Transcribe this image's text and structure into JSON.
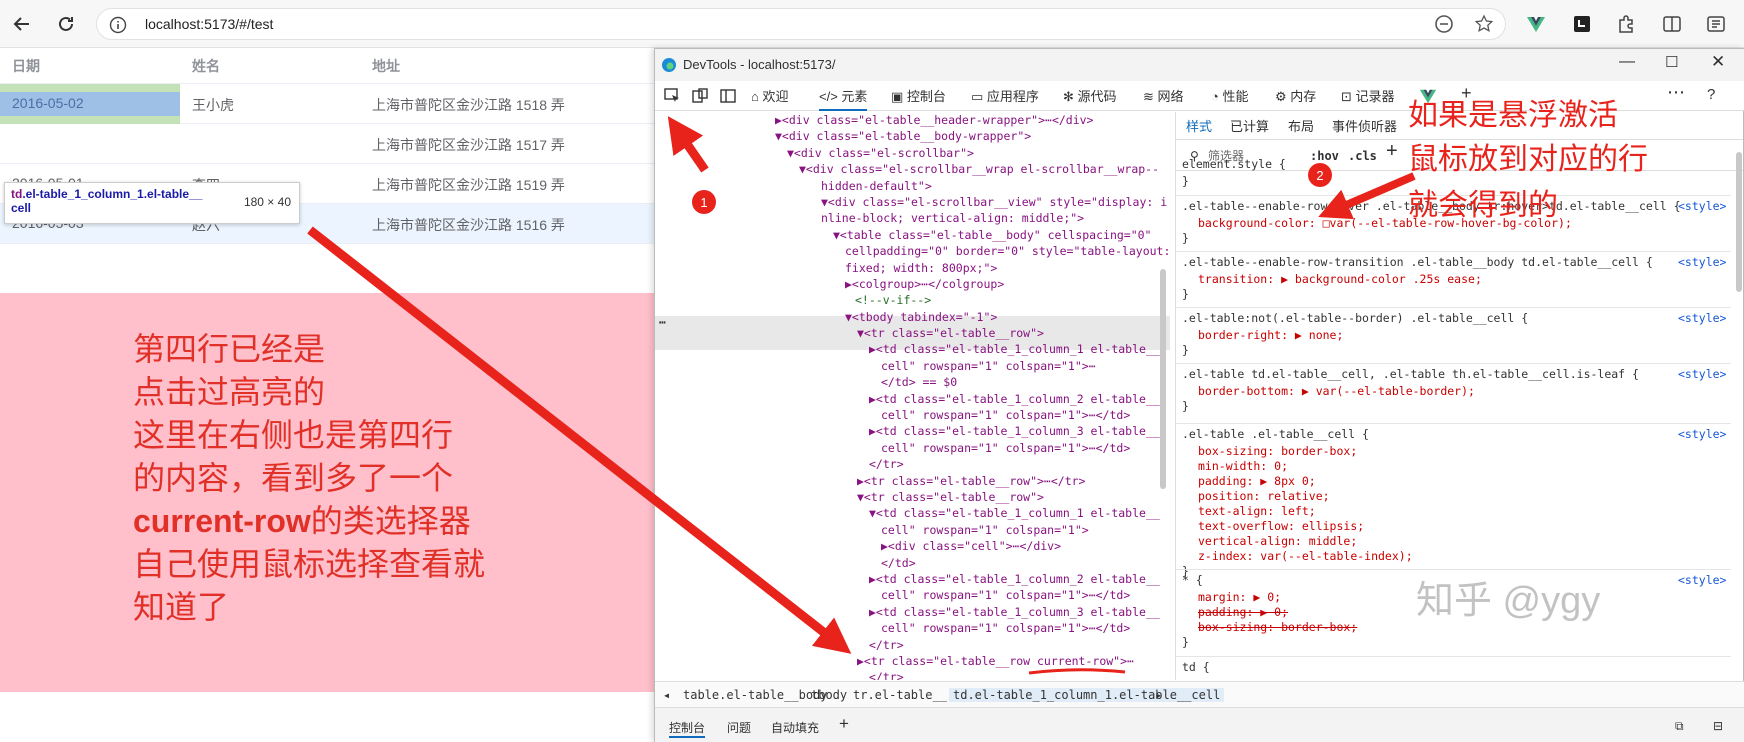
{
  "browser": {
    "url": "localhost:5173/#/test"
  },
  "table": {
    "headers": [
      "日期",
      "姓名",
      "地址"
    ],
    "rows": [
      {
        "date": "2016-05-02",
        "name": "王小虎",
        "address": "上海市普陀区金沙江路 1518 弄"
      },
      {
        "date": "",
        "name": "",
        "address": "上海市普陀区金沙江路 1517 弄"
      },
      {
        "date": "2016-05-01",
        "name": "李四",
        "address": "上海市普陀区金沙江路 1519 弄"
      },
      {
        "date": "2016-05-03",
        "name": "赵六",
        "address": "上海市普陀区金沙江路 1516 弄"
      }
    ],
    "tooltip_selector": "td.el-table_1_column_1.el-table__cell",
    "tooltip_selector_tag": "td",
    "tooltip_selector_rest": ".el-table_1_column_1.el-table__",
    "tooltip_selector_line2": "cell",
    "tooltip_size": "180 × 40"
  },
  "annotation_left": {
    "lines": [
      "第四行已经是",
      "点击过高亮的",
      "这里在右侧也是第四行",
      "的内容，看到多了一个",
      "current-row的类选择器",
      "自己使用鼠标选择查看就",
      "知道了"
    ],
    "bold_part": "current-row",
    "after_bold": "的类选择器"
  },
  "annotation_right": {
    "lines": [
      "如果是悬浮激活",
      "鼠标放到对应的行",
      "就会得到的"
    ],
    "badge1": "1",
    "badge2": "2"
  },
  "devtools": {
    "title": "DevTools - localhost:5173/",
    "tabs": [
      "欢迎",
      "元素",
      "控制台",
      "应用程序",
      "源代码",
      "网络",
      "性能",
      "内存",
      "记录器"
    ],
    "dom_lines": [
      "▶<div class=\"el-table__header-wrapper\">⋯</div>",
      "▼<div class=\"el-table__body-wrapper\">",
      "▼<div class=\"el-scrollbar\">",
      "▼<div class=\"el-scrollbar__wrap el-scrollbar__wrap--",
      "hidden-default\">",
      "▼<div class=\"el-scrollbar__view\" style=\"display: i",
      "nline-block; vertical-align: middle;\">",
      "▼<table class=\"el-table__body\" cellspacing=\"0\"",
      "cellpadding=\"0\" border=\"0\" style=\"table-layout:",
      "fixed; width: 800px;\">",
      "▶<colgroup>⋯</colgroup>",
      "<!--v-if-->",
      "▼<tbody tabindex=\"-1\">",
      "▼<tr class=\"el-table__row\">",
      "▶<td class=\"el-table_1_column_1 el-table__",
      "cell\" rowspan=\"1\" colspan=\"1\">⋯",
      "</td> == $0",
      "▶<td class=\"el-table_1_column_2 el-table__",
      "cell\" rowspan=\"1\" colspan=\"1\">⋯</td>",
      "▶<td class=\"el-table_1_column_3 el-table__",
      "cell\" rowspan=\"1\" colspan=\"1\">⋯</td>",
      "</tr>",
      "▶<tr class=\"el-table__row\">⋯</tr>",
      "▼<tr class=\"el-table__row\">",
      "▼<td class=\"el-table_1_column_1 el-table__",
      "cell\" rowspan=\"1\" colspan=\"1\">",
      "▶<div class=\"cell\">⋯</div>",
      "</td>",
      "▶<td class=\"el-table_1_column_2 el-table__",
      "cell\" rowspan=\"1\" colspan=\"1\">⋯</td>",
      "▶<td class=\"el-table_1_column_3 el-table__",
      "cell\" rowspan=\"1\" colspan=\"1\">⋯</td>",
      "</tr>",
      "▶<tr class=\"el-table__row current-row\">⋯",
      "</tr>"
    ],
    "styles_tabs": [
      "样式",
      "已计算",
      "布局",
      "事件侦听器"
    ],
    "filter_placeholder": "筛选器",
    "hov": ":hov",
    "cls": ".cls",
    "rules": [
      {
        "selector": "element.style {",
        "props": [],
        "source": ""
      },
      {
        "selector": ".el-table--enable-row-hover .el-table__body tr:hover>td.el-table__cell {",
        "props": [
          "background-color: □var(--el-table-row-hover-bg-color);"
        ],
        "source": "<style>"
      },
      {
        "selector": ".el-table--enable-row-transition .el-table__body td.el-table__cell {",
        "props": [
          "transition: ▶ background-color .25s ease;"
        ],
        "source": "<style>"
      },
      {
        "selector": ".el-table:not(.el-table--border) .el-table__cell {",
        "props": [
          "border-right: ▶ none;"
        ],
        "source": "<style>"
      },
      {
        "selector": ".el-table td.el-table__cell, .el-table th.el-table__cell.is-leaf {",
        "props": [
          "border-bottom: ▶ var(--el-table-border);"
        ],
        "source": "<style>"
      },
      {
        "selector": ".el-table .el-table__cell {",
        "props": [
          "box-sizing: border-box;",
          "min-width: 0;",
          "padding: ▶ 8px 0;",
          "position: relative;",
          "text-align: left;",
          "text-overflow: ellipsis;",
          "vertical-align: middle;",
          "z-index: var(--el-table-index);"
        ],
        "source": "<style>"
      },
      {
        "selector": "* {",
        "props": [
          "margin: ▶ 0;",
          "padding: ▶ 0;",
          "box-sizing: border-box;"
        ],
        "source": "<style>"
      },
      {
        "selector": "td {",
        "props": [],
        "source": ""
      }
    ],
    "breadcrumbs": [
      "table.el-table__body",
      "tbody",
      "tr.el-table__row",
      "td.el-table_1_column_1.el-table__cell"
    ],
    "drawer_tabs": [
      "控制台",
      "问题",
      "自动填充"
    ],
    "watermark": "知乎 @ygy"
  },
  "colors": {
    "annotation_red": "#e8231c",
    "pink_bg": "#ffc0cb",
    "highlight_row": "#ecf5ff"
  }
}
